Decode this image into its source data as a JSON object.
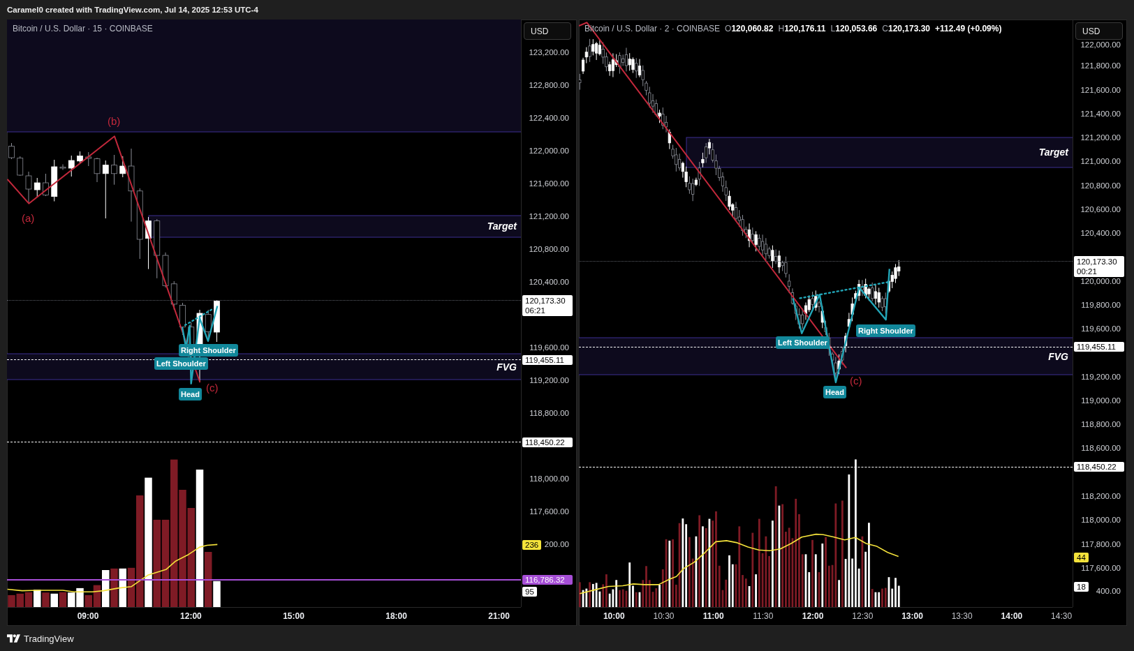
{
  "header": {
    "text": "Caramel0 created with TradingView.com, Jul 14, 2025 12:53 UTC-4"
  },
  "panels": [
    {
      "symbol": "Bitcoin / U.S. Dollar · 15 · COINBASE",
      "currency": "USD",
      "zones": [
        {
          "label": "Target"
        },
        {
          "label": "FVG"
        }
      ],
      "wave_labels": [
        "(a)",
        "(b)",
        "(c)"
      ],
      "pattern_labels": [
        "Right Shoulder",
        "Left Shoulder",
        "Head"
      ],
      "price_scale": [
        "123,200.00",
        "122,800.00",
        "122,400.00",
        "122,000.00",
        "121,600.00",
        "121,200.00",
        "120,800.00",
        "120,400.00",
        "119,600.00",
        "119,200.00",
        "118,800.00",
        "118,000.00",
        "117,600.00",
        "200.00"
      ],
      "price_markers": [
        {
          "kind": "last",
          "text": "120,173.30",
          "countdown": "06:21",
          "color": "#ffffff"
        },
        {
          "kind": "level",
          "text": "119,455.11",
          "color": "#ffffff",
          "dashed": true
        },
        {
          "kind": "level",
          "text": "118,450.22",
          "color": "#ffffff",
          "dashed": true
        },
        {
          "kind": "value",
          "text": "236",
          "color": "#f5e33b"
        },
        {
          "kind": "level",
          "text": "116,786.32",
          "color": "#a64ed6",
          "dashed": false
        },
        {
          "kind": "value",
          "text": "95",
          "color": "#ffffff"
        }
      ],
      "time_scale": [
        {
          "label": "09:00",
          "major": true
        },
        {
          "label": "12:00",
          "major": true
        },
        {
          "label": "15:00",
          "major": true
        },
        {
          "label": "18:00",
          "major": true
        },
        {
          "label": "21:00",
          "major": true
        }
      ]
    },
    {
      "symbol": "Bitcoin / U.S. Dollar · 2 · COINBASE",
      "ohlc": [
        {
          "key": "O",
          "value": "120,060.82"
        },
        {
          "key": "H",
          "value": "120,176.11"
        },
        {
          "key": "L",
          "value": "120,053.66"
        },
        {
          "key": "C",
          "value": "120,173.30"
        }
      ],
      "change": "+112.49 (+0.09%)",
      "currency": "USD",
      "zones": [
        {
          "label": "Target"
        },
        {
          "label": "FVG"
        }
      ],
      "wave_labels": [
        "(c)"
      ],
      "pattern_labels": [
        "Right Shoulder",
        "Left Shoulder",
        "Head"
      ],
      "price_scale": [
        "122,000.00",
        "121,800.00",
        "121,600.00",
        "121,400.00",
        "121,200.00",
        "121,000.00",
        "120,800.00",
        "120,600.00",
        "120,400.00",
        "120,000.00",
        "119,800.00",
        "119,600.00",
        "119,200.00",
        "119,000.00",
        "118,800.00",
        "118,600.00",
        "118,200.00",
        "118,000.00",
        "117,800.00",
        "117,600.00",
        "400.00"
      ],
      "price_markers": [
        {
          "kind": "last",
          "text": "120,173.30",
          "countdown": "00:21",
          "color": "#ffffff"
        },
        {
          "kind": "level",
          "text": "119,455.11",
          "color": "#ffffff",
          "dashed": true
        },
        {
          "kind": "level",
          "text": "118,450.22",
          "color": "#ffffff",
          "dashed": true
        },
        {
          "kind": "value",
          "text": "44",
          "color": "#f5e33b"
        },
        {
          "kind": "value",
          "text": "18",
          "color": "#ffffff"
        }
      ],
      "time_scale": [
        {
          "label": "10:00",
          "major": true
        },
        {
          "label": "10:30",
          "major": false
        },
        {
          "label": "11:00",
          "major": true
        },
        {
          "label": "11:30",
          "major": false
        },
        {
          "label": "12:00",
          "major": true
        },
        {
          "label": "12:30",
          "major": false
        },
        {
          "label": "13:00",
          "major": true
        },
        {
          "label": "13:30",
          "major": false
        },
        {
          "label": "14:00",
          "major": true
        },
        {
          "label": "14:30",
          "major": false
        }
      ]
    }
  ],
  "footer": {
    "brand": "TradingView"
  }
}
